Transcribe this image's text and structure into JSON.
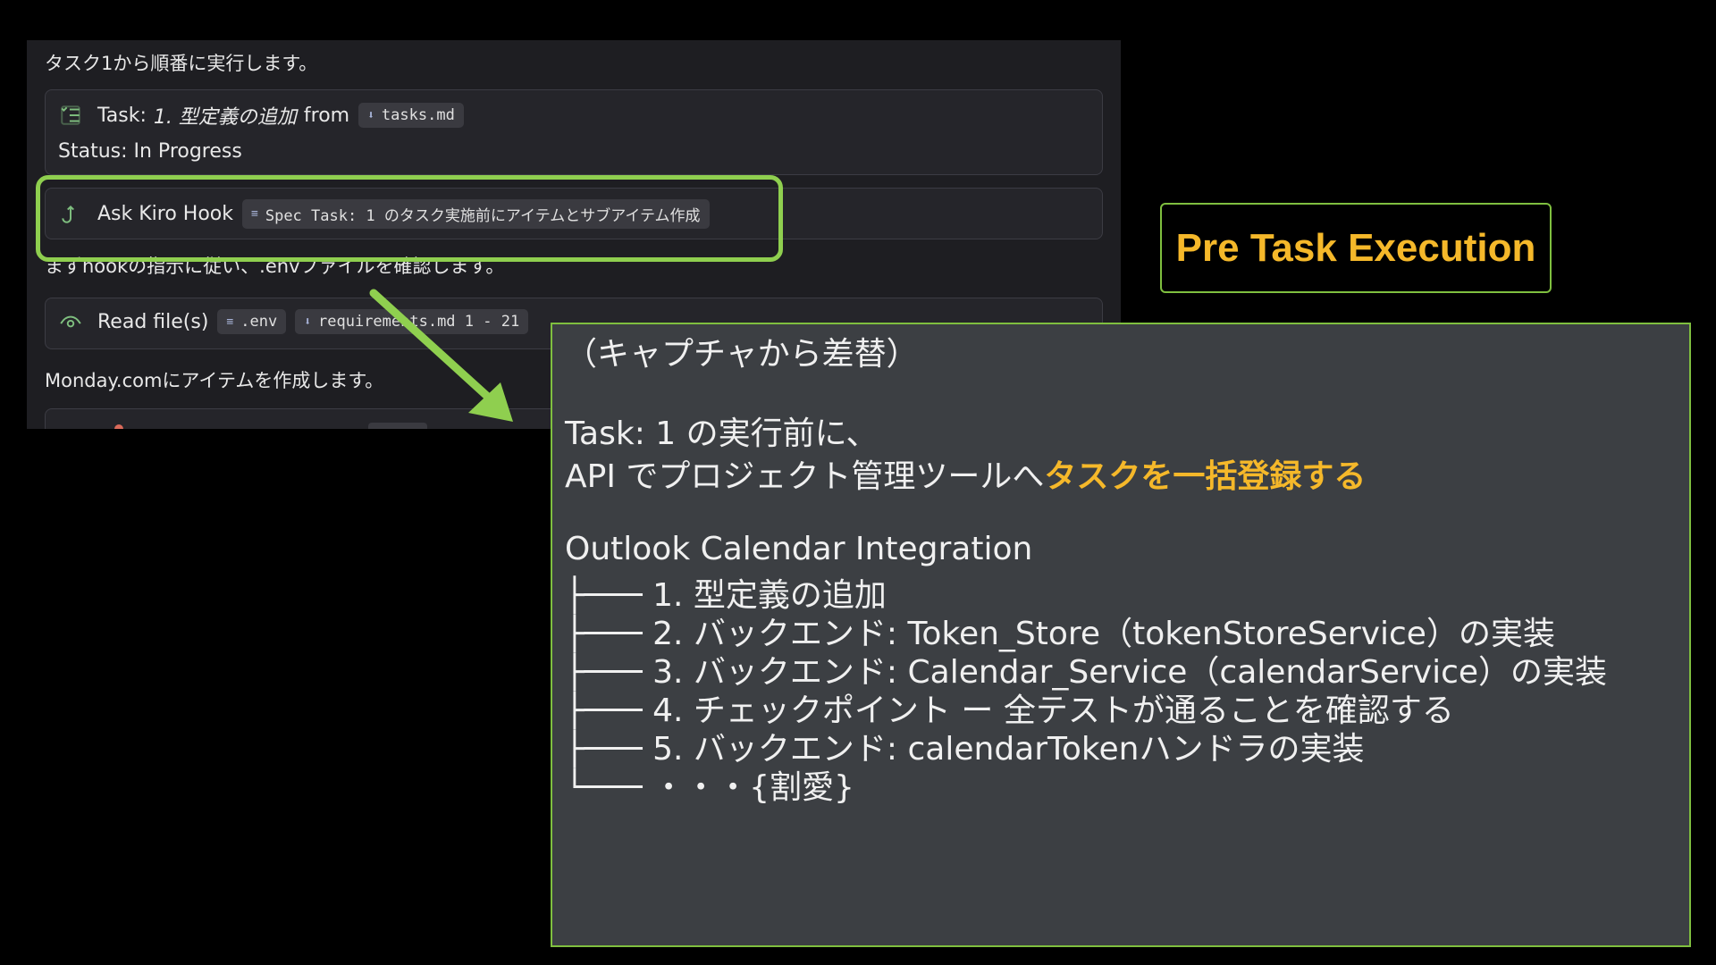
{
  "chat": {
    "intro_text": "タスク1から順番に実行します。",
    "task_card": {
      "prefix": "Task:",
      "task_name": "1. 型定義の追加",
      "from_text": "from",
      "file_chip": "tasks.md",
      "status_text": "Status: In Progress"
    },
    "hook_card": {
      "label": "Ask Kiro Hook",
      "chip": "Spec Task: 1 のタスク実施前にアイテムとサブアイテム作成"
    },
    "hook_follow_text": "まずhookの指示に従い、.envファイルを確認します。",
    "read_card": {
      "label": "Read file(s)",
      "chip1": ".env",
      "chip2": "requirements.md 1 - 21"
    },
    "monday_text": "Monday.comにアイテムを作成します。"
  },
  "label_box": {
    "text": "Pre Task Execution"
  },
  "explanation": {
    "line1": "（キャプチャから差替）",
    "line2": "Task: 1 の実行前に、",
    "line3_normal": "API でプロジェクト管理ツールへ",
    "line3_accent": "タスクを一括登録する",
    "tree_title": "Outlook Calendar Integration",
    "tree_items": [
      "├─── 1. 型定義の追加",
      "├─── 2. バックエンド: Token_Store（tokenStoreService）の実装",
      "├─── 3. バックエンド: Calendar_Service（calendarService）の実装",
      "├─── 4. チェックポイント ー 全テストが通ることを確認する",
      "├─── 5. バックエンド: calendarTokenハンドラの実装",
      "└─── ・・・{割愛}"
    ]
  },
  "colors": {
    "highlight_green": "#8fcf4f",
    "accent_orange": "#f5b82a",
    "panel_gray": "#3c3f43"
  }
}
